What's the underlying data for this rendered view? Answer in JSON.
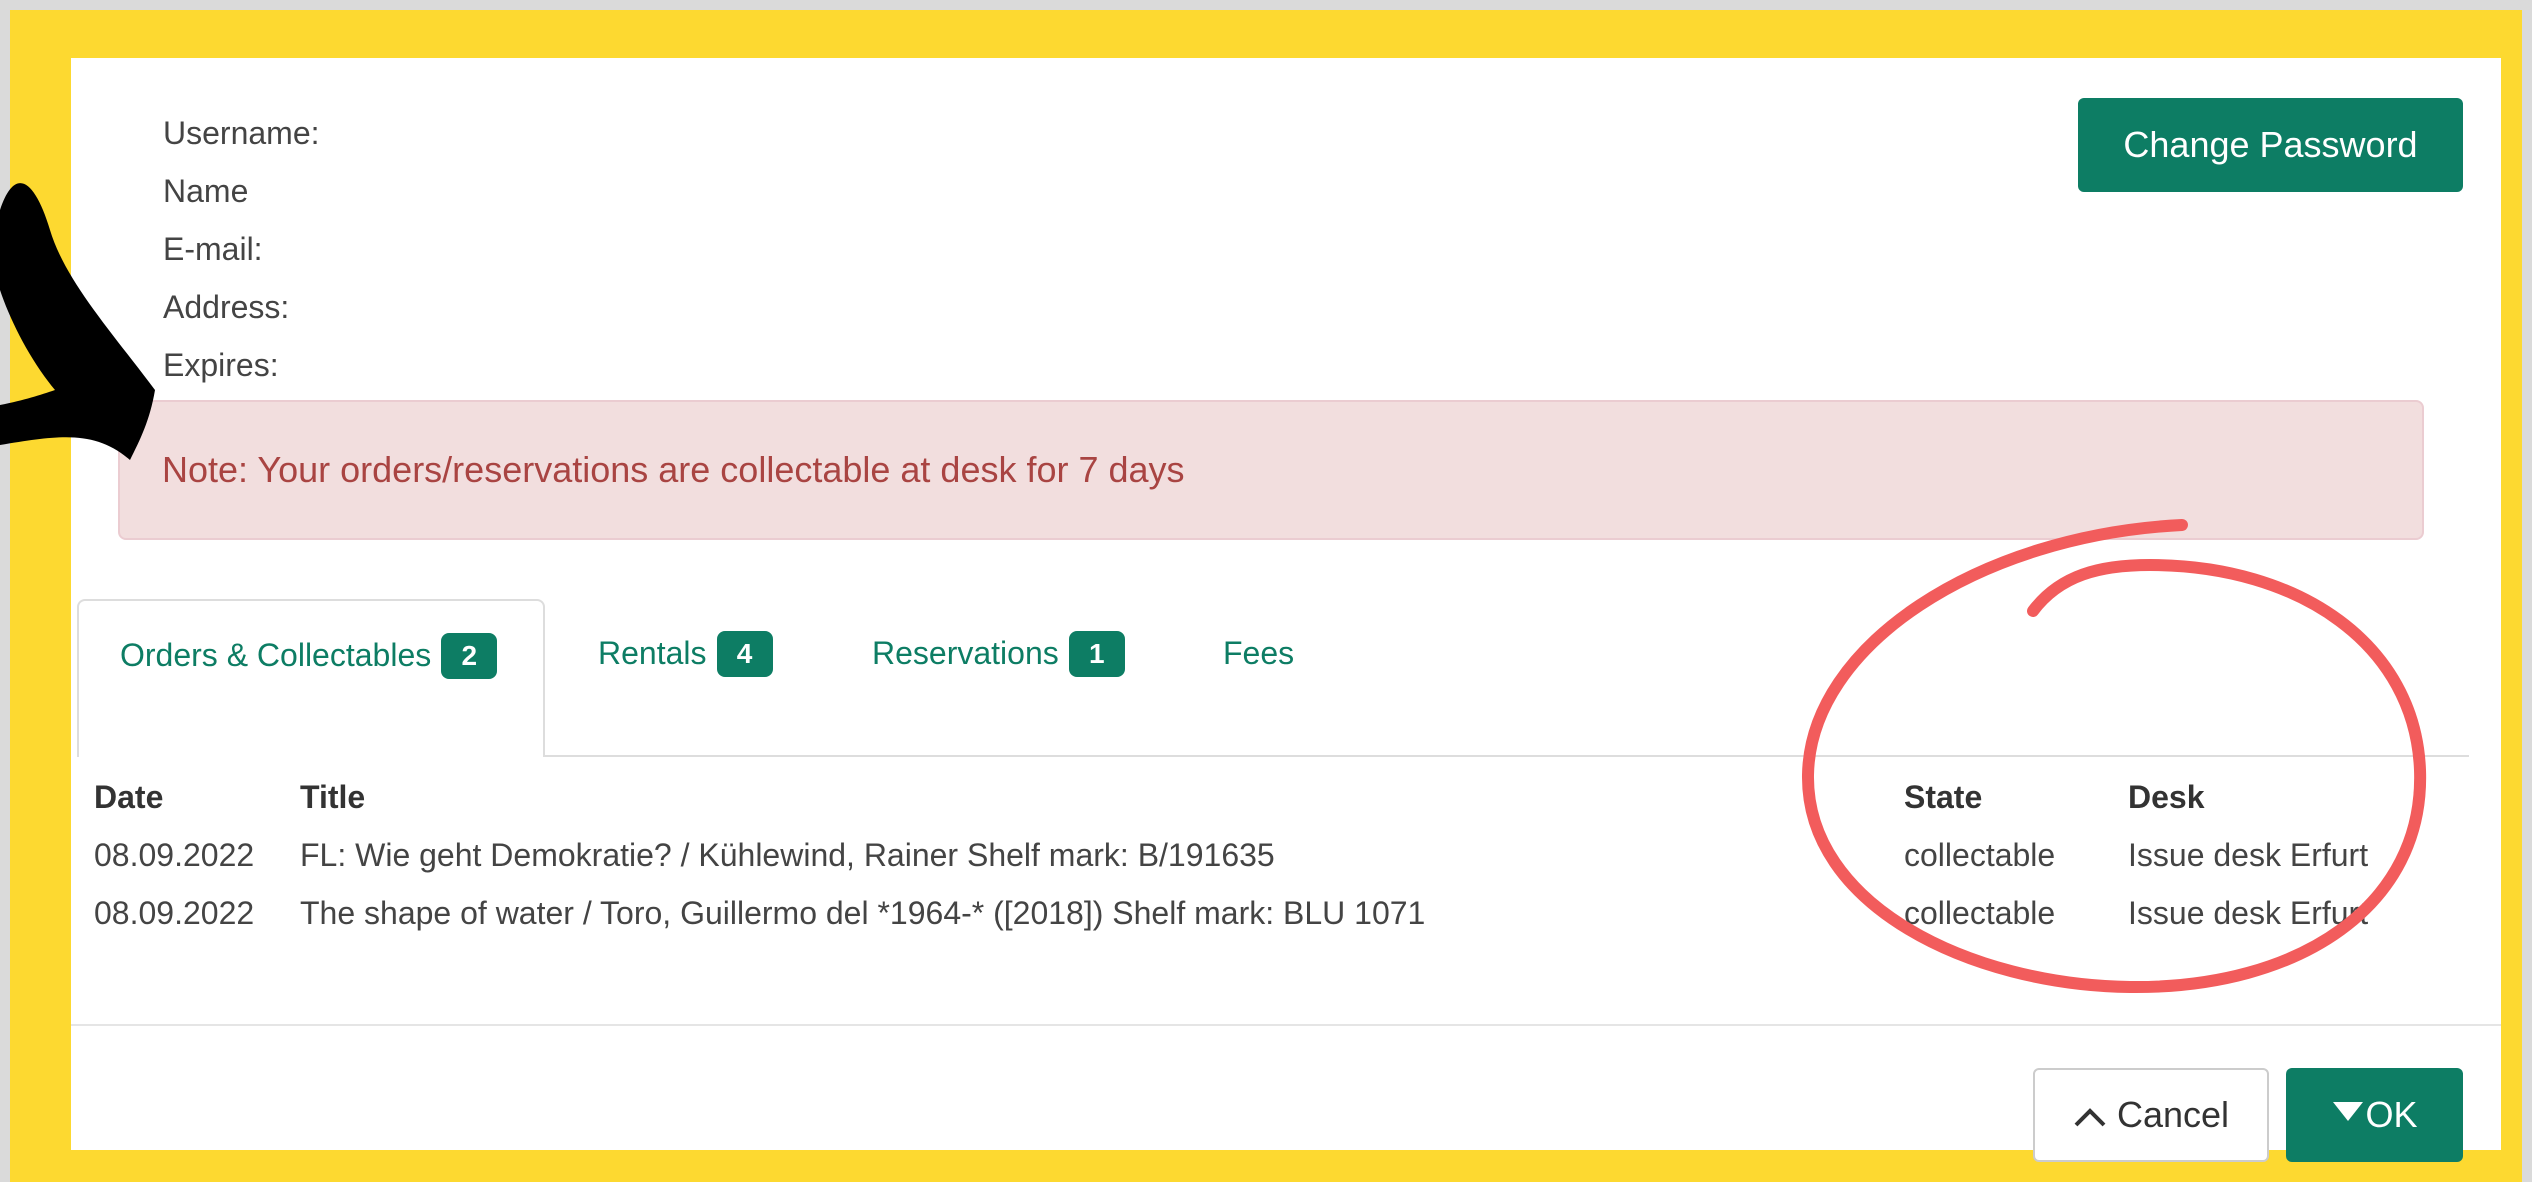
{
  "profile": {
    "username_label": "Username:",
    "name_label": "Name",
    "email_label": "E-mail:",
    "address_label": "Address:",
    "expires_label": "Expires:"
  },
  "change_password_label": "Change Password",
  "note": "Note: Your orders/reservations are collectable at desk for 7 days",
  "tabs": [
    {
      "label": "Orders & Collectables",
      "badge": "2",
      "active": true
    },
    {
      "label": "Rentals",
      "badge": "4"
    },
    {
      "label": "Reservations",
      "badge": "1"
    },
    {
      "label": "Fees",
      "badge": ""
    }
  ],
  "table": {
    "headers": {
      "date": "Date",
      "title": "Title",
      "state": "State",
      "desk": "Desk"
    },
    "rows": [
      {
        "date": "08.09.2022",
        "title": "FL: Wie geht Demokratie? / Kühlewind, Rainer Shelf mark: B/191635",
        "state": "collectable",
        "desk": "Issue desk Erfurt"
      },
      {
        "date": "08.09.2022",
        "title": "The shape of water / Toro, Guillermo del *1964-* ([2018]) Shelf mark: BLU 1071",
        "state": "collectable",
        "desk": "Issue desk Erfurt"
      }
    ]
  },
  "footer": {
    "cancel_label": "Cancel",
    "cancel_icon": "chevron-up-icon",
    "ok_label": "OK",
    "ok_icon": "caret-down-icon"
  },
  "colors": {
    "frame": "#FDD930",
    "accent": "#0d7d64",
    "alert_bg": "#f2dede",
    "alert_text": "#a94442",
    "annotation_circle": "#F25C5C",
    "annotation_arrow": "#000000"
  }
}
